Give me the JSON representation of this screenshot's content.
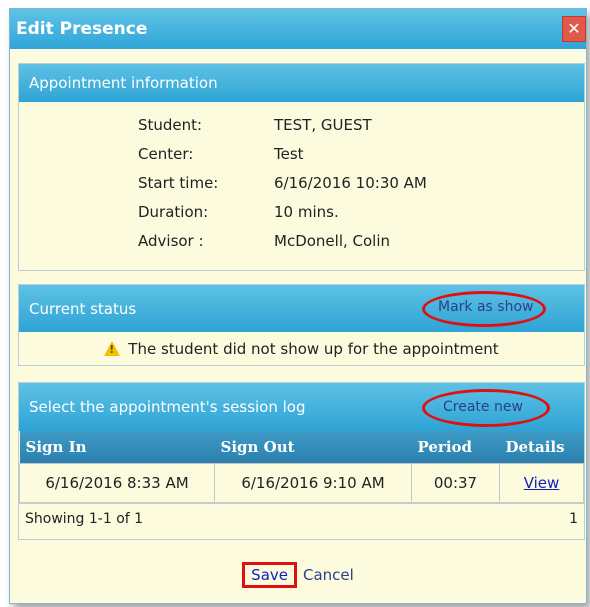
{
  "dialog": {
    "title": "Edit Presence",
    "close_glyph": "✕"
  },
  "appointment": {
    "header": "Appointment information",
    "rows": [
      {
        "label": "Student:",
        "value": "TEST, GUEST"
      },
      {
        "label": "Center:",
        "value": "Test"
      },
      {
        "label": "Start time:",
        "value": "6/16/2016 10:30 AM"
      },
      {
        "label": "Duration:",
        "value": "10 mins."
      },
      {
        "label": "Advisor :",
        "value": "McDonell, Colin"
      }
    ]
  },
  "status": {
    "header": "Current status",
    "action_label": "Mark as show",
    "message": "The student did not show up for the appointment",
    "icon": "warning-icon"
  },
  "session_log": {
    "header": "Select the appointment's session log",
    "action_label": "Create new",
    "columns": [
      "Sign In",
      "Sign Out",
      "Period",
      "Details"
    ],
    "rows": [
      {
        "sign_in": "6/16/2016 8:33 AM",
        "sign_out": "6/16/2016 9:10 AM",
        "period": "00:37",
        "details": "View"
      }
    ],
    "pager_text": "Showing 1-1 of 1",
    "page_number": "1"
  },
  "footer": {
    "save_label": "Save",
    "cancel_label": "Cancel"
  },
  "colors": {
    "accent": "#2fa6d8",
    "highlight": "#e01010",
    "panel_bg": "#fdfbde"
  }
}
